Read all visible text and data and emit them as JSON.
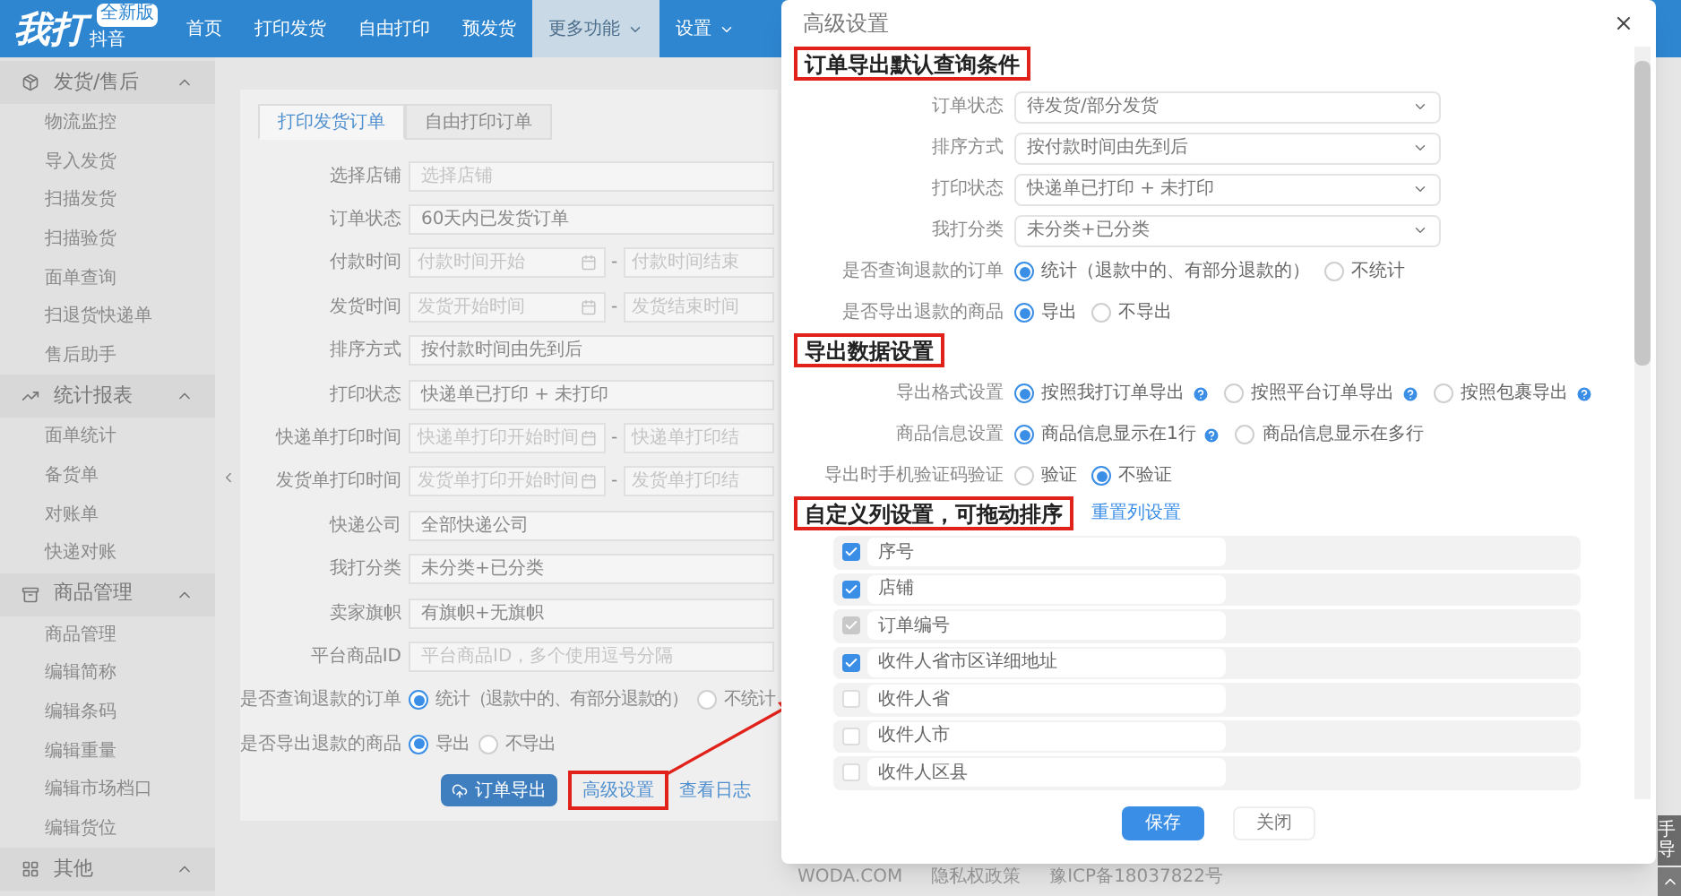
{
  "nav": {
    "logo": "我打",
    "logo_sub": "抖音",
    "badge": "全新版",
    "items": [
      {
        "label": "首页",
        "selected": false,
        "dropdown": false
      },
      {
        "label": "打印发货",
        "selected": false,
        "dropdown": false
      },
      {
        "label": "自由打印",
        "selected": false,
        "dropdown": false
      },
      {
        "label": "预发货",
        "selected": false,
        "dropdown": false
      },
      {
        "label": "更多功能",
        "selected": true,
        "dropdown": true
      },
      {
        "label": "设置",
        "selected": false,
        "dropdown": true
      }
    ]
  },
  "sidebar": {
    "groups": [
      {
        "title": "发货/售后",
        "kind": "box",
        "expanded": true,
        "items": [
          "物流监控",
          "导入发货",
          "扫描发货",
          "扫描验货",
          "面单查询",
          "扫退货快递单",
          "售后助手"
        ]
      },
      {
        "title": "统计报表",
        "kind": "chart",
        "expanded": true,
        "items": [
          "面单统计",
          "备货单",
          "对账单",
          "快递对账"
        ]
      },
      {
        "title": "商品管理",
        "kind": "archive",
        "expanded": true,
        "items": [
          "商品管理",
          "编辑简称",
          "编辑条码",
          "编辑重量",
          "编辑市场档口",
          "编辑货位"
        ]
      },
      {
        "title": "其他",
        "kind": "grid",
        "expanded": true
      }
    ]
  },
  "main": {
    "tabs": [
      {
        "label": "打印发货订单",
        "selected": true
      },
      {
        "label": "自由打印订单",
        "selected": false
      }
    ],
    "form": [
      {
        "label": "选择店铺",
        "kind": "input",
        "placeholder": "选择店铺"
      },
      {
        "label": "订单状态",
        "kind": "input",
        "value": "60天内已发货订单"
      },
      {
        "label": "付款时间",
        "kind": "range",
        "start_placeholder": "付款时间开始",
        "separator": "-",
        "end_placeholder": "付款时间结束"
      },
      {
        "label": "发货时间",
        "kind": "range",
        "start_placeholder": "发货开始时间",
        "separator": "-",
        "end_placeholder": "发货结束时间"
      },
      {
        "label": "排序方式",
        "kind": "input",
        "value": "按付款时间由先到后"
      },
      {
        "label": "打印状态",
        "kind": "input",
        "value": "快递单已打印 + 未打印"
      },
      {
        "label": "快递单打印时间",
        "kind": "range",
        "start_placeholder": "快递单打印开始时间",
        "separator": "-",
        "end_placeholder": "快递单打印结"
      },
      {
        "label": "发货单打印时间",
        "kind": "range",
        "start_placeholder": "发货单打印开始时间",
        "separator": "-",
        "end_placeholder": "发货单打印结"
      },
      {
        "label": "快递公司",
        "kind": "input",
        "value": "全部快递公司"
      },
      {
        "label": "我打分类",
        "kind": "input",
        "value": "未分类+已分类"
      },
      {
        "label": "卖家旗帜",
        "kind": "input",
        "value": "有旗帜+无旗帜"
      },
      {
        "label": "平台商品ID",
        "kind": "input",
        "placeholder": "平台商品ID，多个使用逗号分隔"
      },
      {
        "label": "是否查询退款的订单",
        "kind": "radio",
        "options": [
          {
            "label": "统计（退款中的、有部分退款的）",
            "selected": true
          },
          {
            "label": "不统计",
            "selected": false
          }
        ]
      },
      {
        "label": "是否导出退款的商品",
        "kind": "radio",
        "options": [
          {
            "label": "导出",
            "selected": true
          },
          {
            "label": "不导出",
            "selected": false
          }
        ]
      }
    ],
    "export_button": "订单导出",
    "advanced_link": {
      "label": "高级设置",
      "highlighted": true
    },
    "log_link": "查看日志"
  },
  "footer": [
    "WODA.COM",
    "隐私权政策",
    "豫ICP备18037822号"
  ],
  "side_tab": "手导",
  "modal": {
    "title": "高级设置",
    "sections": [
      {
        "heading": "订单导出默认查询条件",
        "highlighted": true,
        "rows": [
          {
            "label": "订单状态",
            "kind": "select",
            "value": "待发货/部分发货"
          },
          {
            "label": "排序方式",
            "kind": "select",
            "value": "按付款时间由先到后"
          },
          {
            "label": "打印状态",
            "kind": "select",
            "value": "快递单已打印 + 未打印"
          },
          {
            "label": "我打分类",
            "kind": "select",
            "value": "未分类+已分类"
          },
          {
            "label": "是否查询退款的订单",
            "kind": "radio",
            "options": [
              {
                "label": "统计（退款中的、有部分退款的）",
                "selected": true,
                "help": false
              },
              {
                "label": "不统计",
                "selected": false,
                "help": false
              }
            ]
          },
          {
            "label": "是否导出退款的商品",
            "kind": "radio",
            "options": [
              {
                "label": "导出",
                "selected": true,
                "help": false
              },
              {
                "label": "不导出",
                "selected": false,
                "help": false
              }
            ]
          }
        ]
      },
      {
        "heading": "导出数据设置",
        "highlighted": true,
        "rows": [
          {
            "label": "导出格式设置",
            "kind": "radio",
            "options": [
              {
                "label": "按照我打订单导出",
                "selected": true,
                "help": true
              },
              {
                "label": "按照平台订单导出",
                "selected": false,
                "help": true
              },
              {
                "label": "按照包裹导出",
                "selected": false,
                "help": true
              }
            ]
          },
          {
            "label": "商品信息设置",
            "kind": "radio",
            "options": [
              {
                "label": "商品信息显示在1行",
                "selected": true,
                "help": true
              },
              {
                "label": "商品信息显示在多行",
                "selected": false,
                "help": false
              }
            ]
          },
          {
            "label": "导出时手机验证码验证",
            "kind": "radio",
            "options": [
              {
                "label": "验证",
                "selected": false,
                "help": false
              },
              {
                "label": "不验证",
                "selected": true,
                "help": false
              }
            ]
          }
        ]
      },
      {
        "heading": "自定义列设置，可拖动排序",
        "highlighted": true,
        "link": "重置列设置",
        "columns": [
          {
            "label": "序号",
            "checked": true,
            "disabled": false
          },
          {
            "label": "店铺",
            "checked": true,
            "disabled": false
          },
          {
            "label": "订单编号",
            "checked": true,
            "disabled": true
          },
          {
            "label": "收件人省市区详细地址",
            "checked": true,
            "disabled": false
          },
          {
            "label": "收件人省",
            "checked": false,
            "disabled": false
          },
          {
            "label": "收件人市",
            "checked": false,
            "disabled": false
          },
          {
            "label": "收件人区县",
            "checked": false,
            "disabled": false
          }
        ]
      }
    ],
    "buttons": [
      {
        "label": "保存",
        "kind": "primary"
      },
      {
        "label": "关闭",
        "kind": "default"
      }
    ]
  }
}
